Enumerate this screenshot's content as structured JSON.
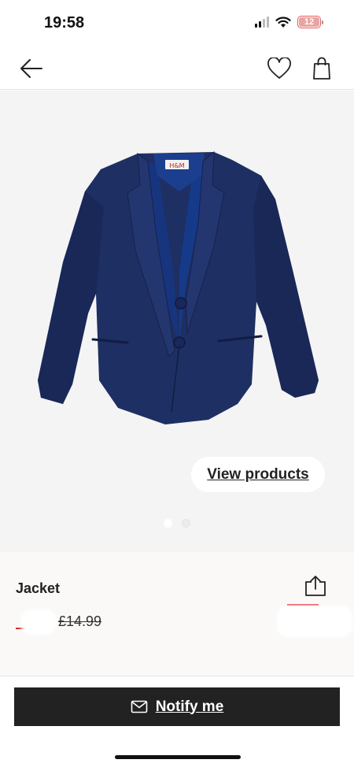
{
  "status_bar": {
    "time": "19:58",
    "battery_level": "12",
    "icons": [
      "signal-icon",
      "wifi-icon",
      "battery-icon"
    ]
  },
  "nav": {
    "back_icon": "arrow-left-icon",
    "favorite_icon": "heart-icon",
    "bag_icon": "shopping-bag-icon"
  },
  "gallery": {
    "image": "navy-blue-blazer-jacket",
    "view_products_label": "View products",
    "slide_count": 2,
    "active_slide": 1
  },
  "product": {
    "name": "Jacket",
    "old_price": "£14.99",
    "share_icon": "share-icon"
  },
  "actions": {
    "notify_label": "Notify me",
    "notify_icon": "envelope-icon"
  },
  "colors": {
    "button_bg": "#222222",
    "gallery_bg": "#f4f4f4",
    "sale_red": "#e0262f",
    "jacket_navy": "#1c2d5e"
  }
}
